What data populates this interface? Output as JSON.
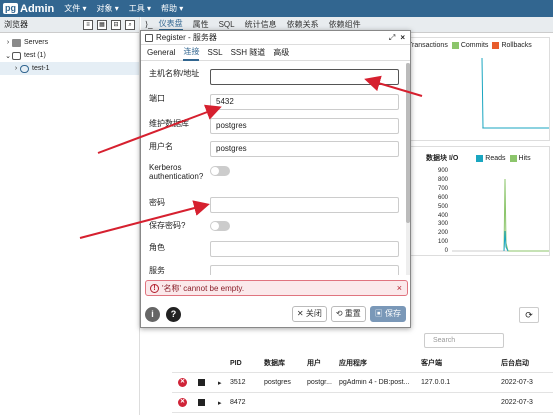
{
  "app": {
    "logo_pg": "pg",
    "logo_admin": "Admin"
  },
  "menubar": {
    "items": [
      "文件 ▾",
      "对象 ▾",
      "工具 ▾",
      "帮助 ▾"
    ]
  },
  "browser": {
    "title": "浏览器",
    "tree": [
      {
        "chevron": "›",
        "label": "Servers"
      },
      {
        "chevron": "⌄",
        "label": "test (1)"
      },
      {
        "chevron": "›",
        "label": "test-1"
      }
    ]
  },
  "tabs": {
    "nav": "⟩_",
    "items": [
      "仪表盘",
      "属性",
      "SQL",
      "统计信息",
      "依赖关系",
      "依赖组件"
    ]
  },
  "charts": {
    "tps_legend": [
      "Transactions",
      "Commits",
      "Rollbacks"
    ],
    "io_title": "数据块 I/O",
    "io_legend": [
      "Reads",
      "Hits"
    ],
    "io_ticks": [
      "900",
      "800",
      "700",
      "600",
      "500",
      "400",
      "300",
      "200",
      "100",
      "0"
    ],
    "colors": {
      "transactions": "#1aa6c0",
      "commits": "#8cc56b",
      "rollbacks": "#e85c2c",
      "reads": "#1aa6c0",
      "hits": "#8cc56b"
    }
  },
  "dialog": {
    "title": "Register - 服务器",
    "expand": "⤢",
    "close": "×",
    "tabs": [
      "General",
      "连接",
      "SSL",
      "SSH 隧道",
      "高级"
    ],
    "fields": [
      {
        "label": "主机名称/地址",
        "value": ""
      },
      {
        "label": "端口",
        "value": "5432"
      },
      {
        "label": "维护数据库",
        "value": "postgres"
      },
      {
        "label": "用户名",
        "value": "postgres"
      },
      {
        "label": "Kerberos authentication?",
        "value": ""
      },
      {
        "label": "密码",
        "value": ""
      },
      {
        "label": "保存密码?",
        "value": ""
      },
      {
        "label": "角色",
        "value": ""
      },
      {
        "label": "服务",
        "value": ""
      }
    ],
    "error": {
      "icon": "!",
      "message": "'名称' cannot be empty.",
      "close": "×"
    },
    "footer": {
      "info": "i",
      "help": "?",
      "close_label": "✕ 关闭",
      "reset_label": "⟲ 重置",
      "save_label": "▣ 保存"
    }
  },
  "sessions": {
    "search_placeholder": "Search",
    "refresh": "⟳",
    "columns": [
      "PID",
      "数据库",
      "用户",
      "应用程序",
      "客户端",
      "后台启动"
    ],
    "rows": [
      {
        "pid": "3512",
        "db": "postgres",
        "user": "postgr...",
        "app": "pgAdmin 4 - DB:post...",
        "client": "127.0.0.1",
        "start": "2022-07-3"
      },
      {
        "pid": "8472",
        "db": "",
        "user": "",
        "app": "",
        "client": "",
        "start": "2022-07-3"
      }
    ]
  },
  "annotation_color": "#d6202f"
}
